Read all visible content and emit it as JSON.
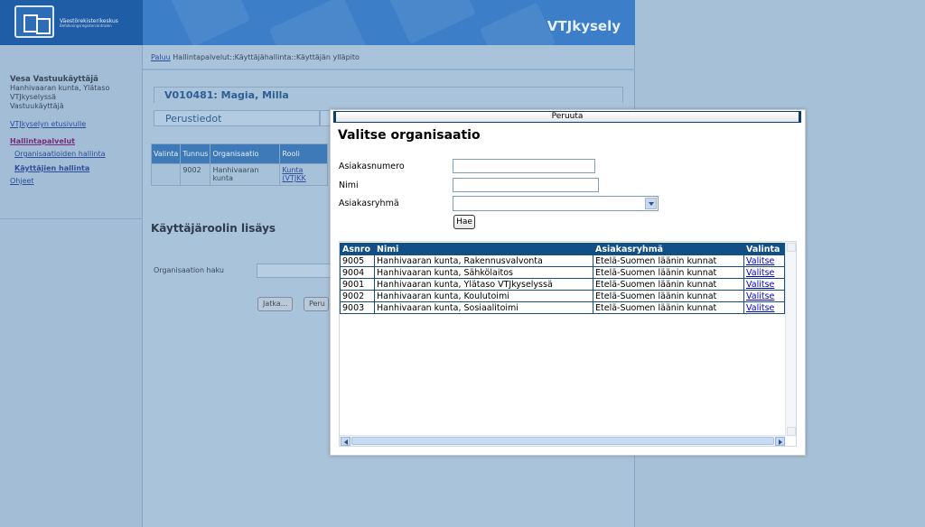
{
  "app": {
    "brand": "VTJkysely",
    "logo_text": "Väestörekisterikeskus",
    "logo_subtext": "Befolkningsregistercentralen"
  },
  "sidebar": {
    "user_name": "Vesa Vastuukäyttäjä",
    "user_org": "Hanhivaaran kunta, Ylätaso",
    "user_org2": "VTJkyselyssä",
    "user_role": "Vastuukäyttäjä",
    "links": [
      {
        "label": "VTJkyselyn etusivulle"
      },
      {
        "label": "Hallintapalvelut"
      },
      {
        "label": "Organisaatioiden hallinta"
      },
      {
        "label": "Käyttäjien hallinta"
      },
      {
        "label": "Ohjeet"
      }
    ]
  },
  "main": {
    "breadcrumb_back": "Paluu",
    "breadcrumb_path": "Hallintapalvelut::Käyttäjähallinta::Käyttäjän ylläpito",
    "user_title": "V010481: Magia, Milla",
    "tab_basic": "Perustiedot",
    "role_table": {
      "headers": [
        "Valinta",
        "Tunnus",
        "Organisaatio",
        "Rooli"
      ],
      "row": {
        "id": "9002",
        "org": "Hanhivaaran kunta",
        "role": "Kunta (VTJKK"
      }
    },
    "section_title": "Käyttäjäroolin lisäys",
    "org_search_label": "Organisaation haku",
    "btn_continue": "Jatka...",
    "btn_cancel": "Peru"
  },
  "modal": {
    "cancel_label": "Peruuta",
    "title": "Valitse organisaatio",
    "fields": {
      "customer_number_label": "Asiakasnumero",
      "name_label": "Nimi",
      "group_label": "Asiakasryhmä",
      "customer_number_value": "",
      "name_value": "",
      "group_value": ""
    },
    "search_label": "Hae",
    "table": {
      "headers": [
        "Asnro",
        "Nimi",
        "Asiakasryhmä",
        "Valinta"
      ],
      "rows": [
        {
          "asnro": "9005",
          "nimi": "Hanhivaaran kunta, Rakennusvalvonta",
          "ryhma": "Etelä-Suomen läänin kunnat",
          "valinta": "Valitse"
        },
        {
          "asnro": "9004",
          "nimi": "Hanhivaaran kunta, Sähkölaitos",
          "ryhma": "Etelä-Suomen läänin kunnat",
          "valinta": "Valitse"
        },
        {
          "asnro": "9001",
          "nimi": "Hanhivaaran kunta, Ylätaso VTJkyselyssä",
          "ryhma": "Etelä-Suomen läänin kunnat",
          "valinta": "Valitse"
        },
        {
          "asnro": "9002",
          "nimi": "Hanhivaaran kunta, Koulutoimi",
          "ryhma": "Etelä-Suomen läänin kunnat",
          "valinta": "Valitse"
        },
        {
          "asnro": "9003",
          "nimi": "Hanhivaaran kunta, Sosiaalitoimi",
          "ryhma": "Etelä-Suomen läänin kunnat",
          "valinta": "Valitse"
        }
      ]
    }
  },
  "colors": {
    "header_blue": "#124f86",
    "banner_blue": "#3c7ec7",
    "page_bg": "#a6c0d8"
  }
}
